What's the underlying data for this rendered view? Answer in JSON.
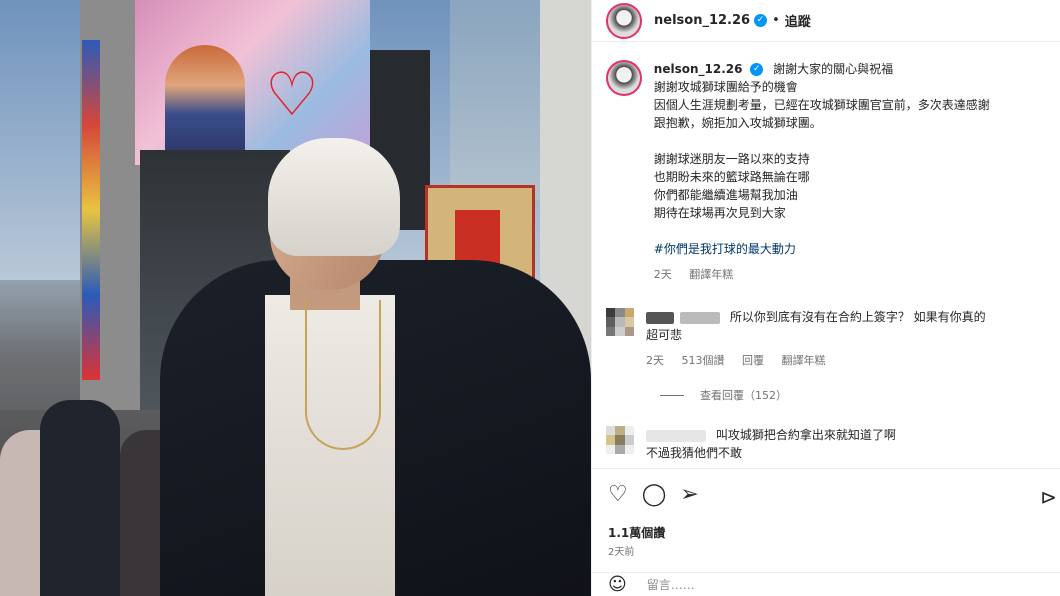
{
  "header": {
    "username": "nelson_12.26",
    "separator": "•",
    "follow_label": "追蹤",
    "verified_glyph": "✓"
  },
  "caption": {
    "username": "nelson_12.26",
    "first_line": "謝謝大家的關心與祝福",
    "lines": [
      "謝謝攻城獅球團給予的機會",
      "因個人生涯規劃考量，已經在攻城獅球團官宣前，多次表達感謝",
      "跟抱歉，婉拒加入攻城獅球團。",
      "",
      "謝謝球迷朋友一路以來的支持",
      "也期盼未來的籃球路無論在哪",
      "你們都能繼續進場幫我加油",
      "期待在球場再次見到大家",
      "",
      "#你們是我打球的最大動力"
    ],
    "time": "2天",
    "translate": "翻譯年糕"
  },
  "comments": [
    {
      "text_line1": "所以你到底有沒有在合約上簽字？ 如果有你真的",
      "text_line2": "超可悲",
      "time": "2天",
      "likes": "513個讚",
      "reply": "回覆",
      "translate": "翻譯年糕"
    },
    {
      "text_line1": "叫攻城獅把合約拿出來就知道了啊",
      "text_line2": "不過我猜他們不敢"
    }
  ],
  "view_replies": "查看回覆（152）",
  "actions": {
    "like_icon": "heart-icon",
    "comment_icon": "comment-icon",
    "share_icon": "share-icon",
    "save_icon": "bookmark-icon"
  },
  "stats": {
    "likes": "1.1萬個讚",
    "posted": "2天前"
  },
  "add_comment": {
    "placeholder": "留言……"
  },
  "colors": {
    "verified": "#0095f6",
    "hashtag": "#00376b",
    "secondary_text": "#737373"
  }
}
